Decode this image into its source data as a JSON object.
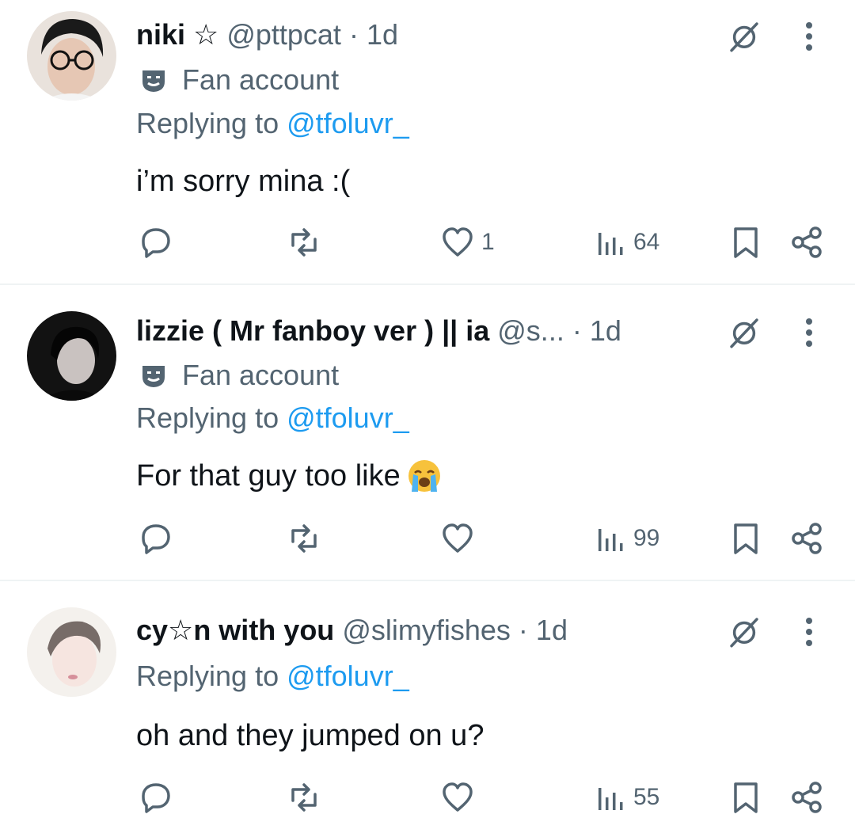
{
  "tweets": [
    {
      "name": "niki ☆",
      "handle": "@pttpcat",
      "dot": "·",
      "time": "1d",
      "label": "Fan account",
      "replying_prefix": "Replying to ",
      "replying_to": "@tfoluvr_",
      "text": "i’m sorry mina :(",
      "stats": {
        "replies": "",
        "retweets": "",
        "likes": "1",
        "views": "64"
      }
    },
    {
      "name": "lizzie ( Mr fanboy ver ) || ia",
      "handle": "@s...",
      "dot": " ·",
      "time": "1d",
      "label": "Fan account",
      "replying_prefix": "Replying to ",
      "replying_to": "@tfoluvr_",
      "text": "For that guy too like",
      "emoji": "loudly-crying-face",
      "stats": {
        "replies": "",
        "retweets": "",
        "likes": "",
        "views": "99"
      }
    },
    {
      "name": "cy☆n with you",
      "handle": "@slimyfishes",
      "dot": "·",
      "time": "1d",
      "replying_prefix": "Replying to ",
      "replying_to": "@tfoluvr_",
      "text": "oh and they jumped on u?",
      "stats": {
        "replies": "",
        "retweets": "",
        "likes": "",
        "views": "55"
      }
    }
  ],
  "colors": {
    "text": "#0f1419",
    "secondary": "#536471",
    "link": "#1d9bf0",
    "divider": "#eff3f4"
  }
}
